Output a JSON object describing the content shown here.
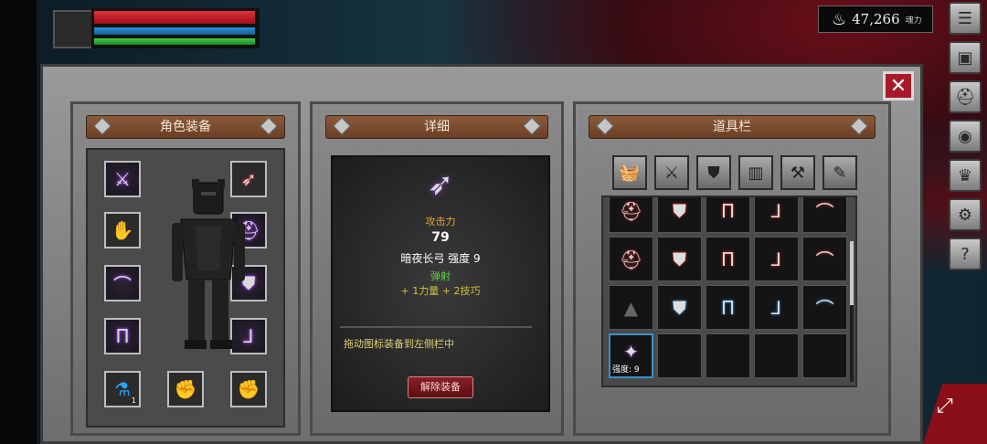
{
  "hud": {
    "soul_value": "47,266",
    "soul_unit": "魂力",
    "soul_icon": "flame-icon"
  },
  "sidebar": [
    "list-icon",
    "equipment-icon",
    "helmet-icon",
    "emblem-icon",
    "crown-icon",
    "gear-icon",
    "help-icon"
  ],
  "panels": {
    "equipment": {
      "title": "角色装备"
    },
    "detail": {
      "title": "详细"
    },
    "inventory": {
      "title": "道具栏"
    }
  },
  "detail": {
    "stat_label": "攻击力",
    "stat_value": "79",
    "item_line": "暗夜长弓 强度 9",
    "trait": "弹射",
    "bonus": "+ 1力量  + 2技巧",
    "hint": "拖动图标装备到左侧栏中",
    "unequip_label": "解除装备"
  },
  "equipment_slots": [
    {
      "icon": "sword-icon",
      "glow": "purple"
    },
    {
      "icon": "bow-icon",
      "glow": "red"
    },
    {
      "icon": "gauntlet-icon",
      "glow": "none"
    },
    {
      "icon": "helmet-icon",
      "glow": "purple"
    },
    {
      "icon": "bracer-icon",
      "glow": "purple"
    },
    {
      "icon": "chest-armor-icon",
      "glow": "purple"
    },
    {
      "icon": "leggings-icon",
      "glow": "purple"
    },
    {
      "icon": "boots-icon",
      "glow": "purple"
    },
    {
      "icon": "potion-icon",
      "glow": "none",
      "count": "1"
    },
    {
      "icon": "empty-gloves-icon",
      "glow": "none"
    },
    {
      "icon": "empty-gloves-icon",
      "glow": "none"
    }
  ],
  "inventory_categories": [
    "all-items-icon",
    "weapon-icon",
    "armor-icon",
    "accessory-icon",
    "tools-icon",
    "scroll-icon"
  ],
  "inventory_items": [
    {
      "icon": "helmet-icon",
      "glow": "red"
    },
    {
      "icon": "chest-armor-icon",
      "glow": "red"
    },
    {
      "icon": "leggings-icon",
      "glow": "red"
    },
    {
      "icon": "boots-icon",
      "glow": "red"
    },
    {
      "icon": "bracer-icon",
      "glow": "red"
    },
    {
      "icon": "helmet-icon",
      "glow": "red"
    },
    {
      "icon": "chest-armor-icon",
      "glow": "red"
    },
    {
      "icon": "leggings-icon",
      "glow": "red"
    },
    {
      "icon": "boots-icon",
      "glow": "red"
    },
    {
      "icon": "bracer-icon",
      "glow": "red"
    },
    {
      "icon": "hat-icon",
      "glow": "none"
    },
    {
      "icon": "chest-armor-icon",
      "glow": "blue"
    },
    {
      "icon": "leggings-icon",
      "glow": "blue"
    },
    {
      "icon": "boots-icon",
      "glow": "blue"
    },
    {
      "icon": "bracer-icon",
      "glow": "blue"
    },
    {
      "icon": "upgrade-stone-icon",
      "glow": "purple",
      "label": "强度: 9"
    },
    {
      "icon": "",
      "glow": "none"
    },
    {
      "icon": "",
      "glow": "none"
    },
    {
      "icon": "",
      "glow": "none"
    },
    {
      "icon": "",
      "glow": "none"
    }
  ]
}
